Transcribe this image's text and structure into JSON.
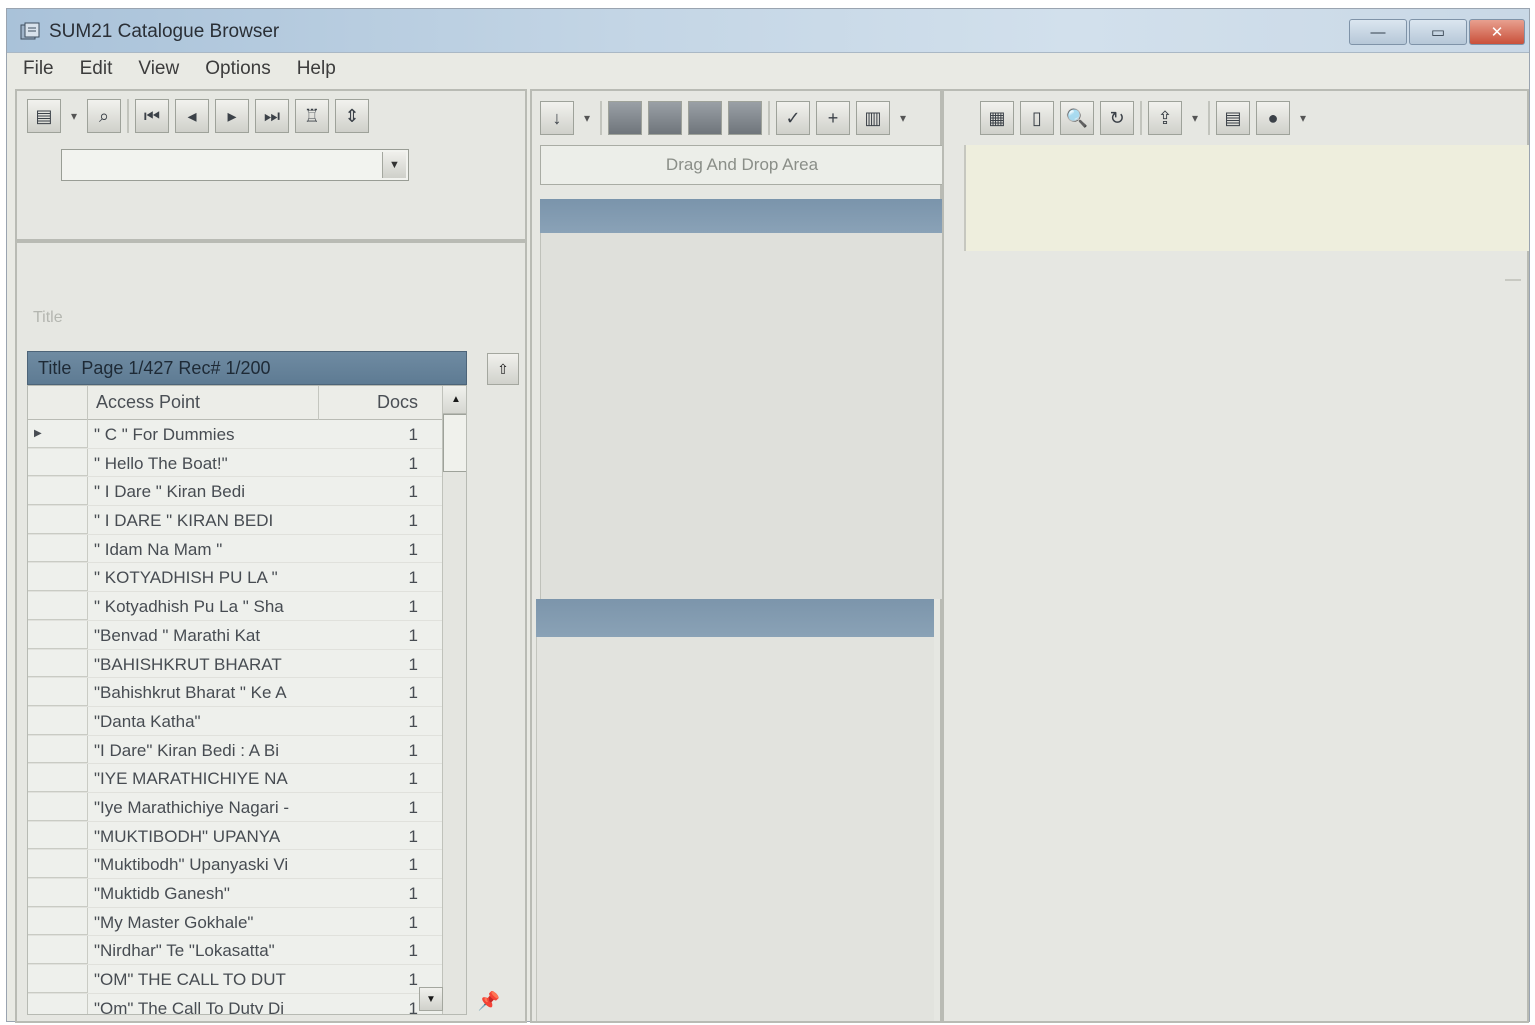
{
  "window": {
    "title": "SUM21 Catalogue Browser",
    "controls": {
      "minimize": "—",
      "maximize": "▭",
      "close": "✕"
    }
  },
  "menu": [
    "File",
    "Edit",
    "View",
    "Options",
    "Help"
  ],
  "left_toolbar": {
    "icons": [
      "database-icon",
      "binoculars-icon",
      "first-record-icon",
      "prev-record-icon",
      "next-record-icon",
      "last-record-icon",
      "trophy-icon",
      "sort-icon"
    ]
  },
  "search": {
    "combo_value": ""
  },
  "browse": {
    "field_label": "Title",
    "header_title": "Title",
    "header_info": "Page 1/427 Rec# 1/200",
    "columns": {
      "access_point": "Access Point",
      "docs": "Docs"
    },
    "rows": [
      {
        "text": "\" C \" For Dummies",
        "docs": "1"
      },
      {
        "text": "\" Hello The Boat!\"",
        "docs": "1"
      },
      {
        "text": "\" I Dare \" Kiran Bedi",
        "docs": "1"
      },
      {
        "text": "\" I DARE \" KIRAN BEDI",
        "docs": "1"
      },
      {
        "text": "\" Idam Na Mam \"",
        "docs": "1"
      },
      {
        "text": "\" KOTYADHISH PU LA \"",
        "docs": "1"
      },
      {
        "text": "\" Kotyadhish Pu La \" Sha",
        "docs": "1"
      },
      {
        "text": "\"Benvad \" Marathi Kat",
        "docs": "1"
      },
      {
        "text": "\"BAHISHKRUT BHARAT",
        "docs": "1"
      },
      {
        "text": "\"Bahishkrut Bharat \" Ke A",
        "docs": "1"
      },
      {
        "text": "\"Danta Katha\"",
        "docs": "1"
      },
      {
        "text": "\"I Dare\" Kiran Bedi : A Bi",
        "docs": "1"
      },
      {
        "text": "\"IYE MARATHICHIYE NA",
        "docs": "1"
      },
      {
        "text": "\"Iye Marathichiye Nagari -",
        "docs": "1"
      },
      {
        "text": "\"MUKTIBODH\" UPANYA",
        "docs": "1"
      },
      {
        "text": "\"Muktibodh\" Upanyaski Vi",
        "docs": "1"
      },
      {
        "text": "\"Muktidb Ganesh\"",
        "docs": "1"
      },
      {
        "text": "\"My Master Gokhale\"",
        "docs": "1"
      },
      {
        "text": "\"Nirdhar\" Te \"Lokasatta\"",
        "docs": "1"
      },
      {
        "text": "\"OM\" THE CALL TO DUT",
        "docs": "1"
      },
      {
        "text": "\"Om\" The Call To Duty Di",
        "docs": "1"
      }
    ]
  },
  "middle": {
    "drag_drop_label": "Drag And Drop Area"
  }
}
